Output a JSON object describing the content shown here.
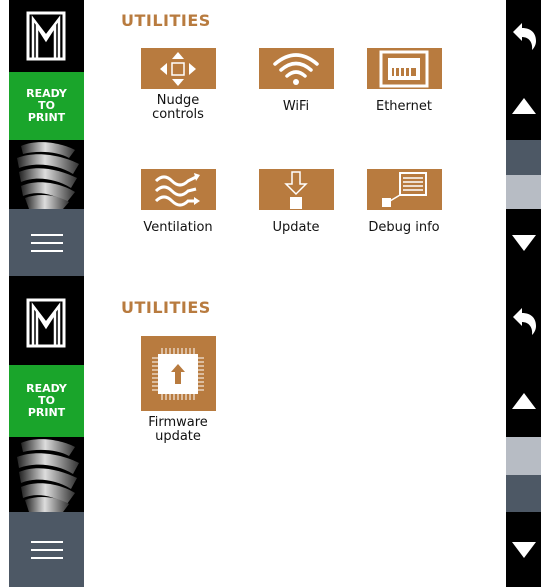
{
  "screens": [
    {
      "title": "UTILITIES",
      "status": [
        "READY",
        "TO",
        "PRINT"
      ],
      "tiles": [
        {
          "label": "Nudge controls",
          "icon": "nudge-arrows-icon"
        },
        {
          "label": "WiFi",
          "icon": "wifi-icon"
        },
        {
          "label": "Ethernet",
          "icon": "ethernet-port-icon"
        },
        {
          "label": "Ventilation",
          "icon": "air-waves-icon"
        },
        {
          "label": "Update",
          "icon": "download-update-icon"
        },
        {
          "label": "Debug info",
          "icon": "debug-screen-icon"
        }
      ]
    },
    {
      "title": "UTILITIES",
      "status": [
        "READY",
        "TO",
        "PRINT"
      ],
      "tiles": [
        {
          "label": "Firmware update",
          "icon": "firmware-chip-icon"
        }
      ]
    }
  ],
  "colors": {
    "accent": "#b87b3f",
    "status_green": "#1aa52b",
    "menu_gray": "#4d5865",
    "scroll_dark": "#4d5865",
    "scroll_light": "#b7bcc4"
  }
}
